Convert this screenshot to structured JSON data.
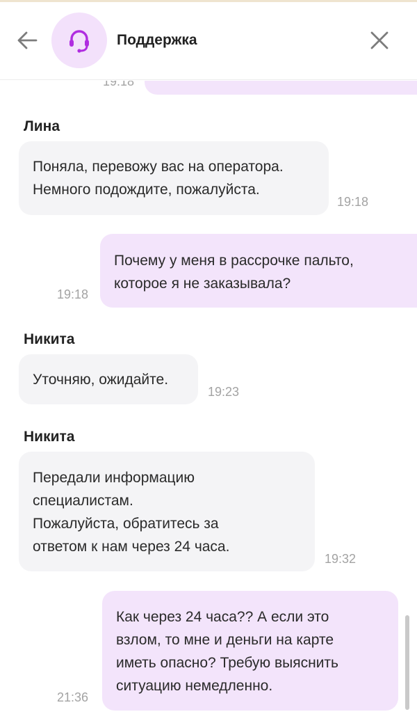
{
  "header": {
    "title": "Поддержка"
  },
  "chat": {
    "partial_time": "19:18",
    "messages": [
      {
        "sender": "Лина",
        "lines": [
          "Поняла, перевожу вас на оператора.",
          "Немного подождите, пожалуйста."
        ],
        "time": "19:18"
      },
      {
        "sender": "",
        "lines": [
          "Почему у меня в рассрочке пальто,",
          "которое я не заказывала?"
        ],
        "time": "19:18"
      },
      {
        "sender": "Никита",
        "lines": [
          "Уточняю, ожидайте."
        ],
        "time": "19:23"
      },
      {
        "sender": "Никита",
        "lines": [
          "Передали информацию",
          "специалистам.",
          "Пожалуйста, обратитесь за",
          "ответом к нам через 24 часа."
        ],
        "time": "19:32"
      },
      {
        "sender": "",
        "lines": [
          "Как через 24 часа?? А если это",
          "взлом, то мне и деньги на карте",
          "иметь опасно? Требую выяснить",
          "ситуацию немедленно."
        ],
        "time": "21:36"
      }
    ]
  },
  "colors": {
    "incoming_bubble": "#f4f4f6",
    "outgoing_bubble": "#f3e4fb",
    "accent": "#b02de0",
    "avatar_bg": "#f3e1fb"
  },
  "icons": {
    "back": "arrow-left-icon",
    "support": "headset-icon",
    "close": "close-icon"
  }
}
